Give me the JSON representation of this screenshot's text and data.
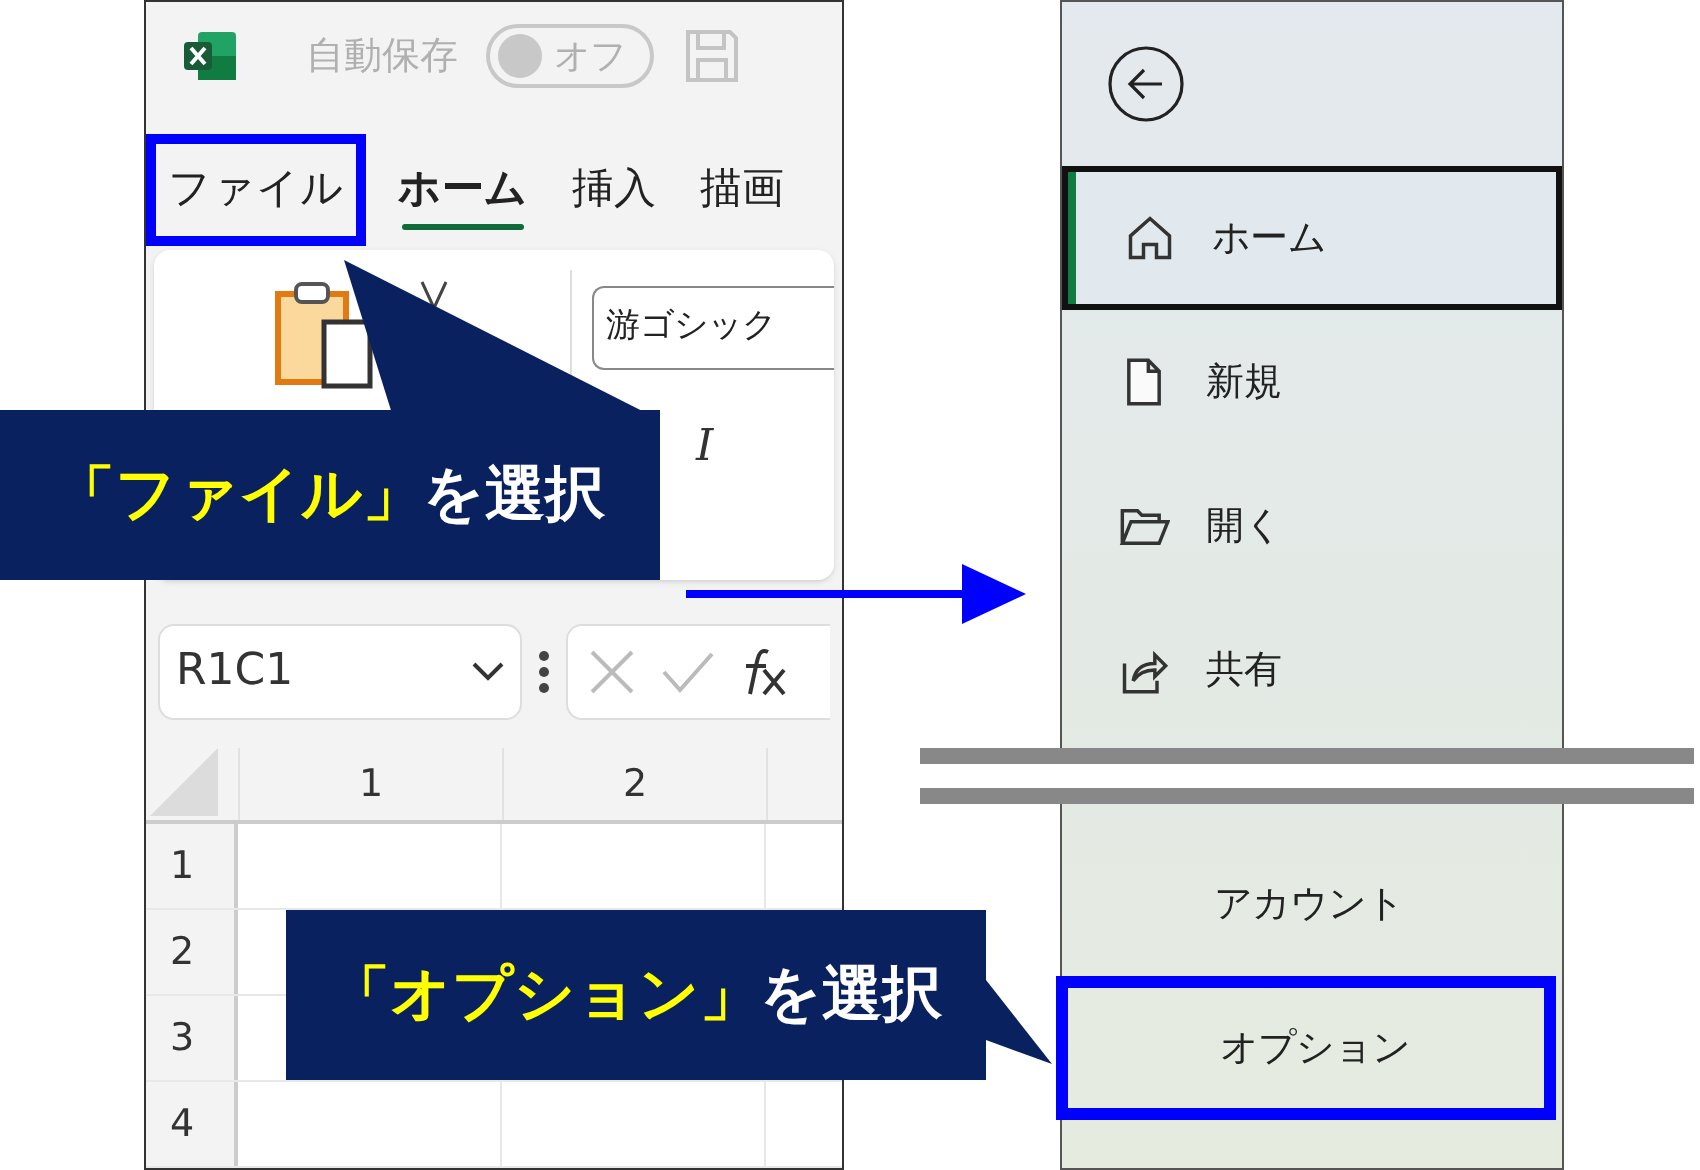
{
  "excel_window": {
    "title_bar": {
      "autosave_label": "自動保存",
      "autosave_toggle": {
        "label": "オフ",
        "on": false
      }
    },
    "tabs": [
      {
        "label": "ファイル",
        "selected": false,
        "highlighted": true
      },
      {
        "label": "ホーム",
        "selected": true,
        "highlighted": false
      },
      {
        "label": "挿入",
        "selected": false,
        "highlighted": false
      },
      {
        "label": "描画",
        "selected": false,
        "highlighted": false
      }
    ],
    "ribbon": {
      "font_name": "游ゴシック",
      "italic_button": "I"
    },
    "formula_bar": {
      "name_box": "R1C1"
    },
    "column_headers": [
      "1",
      "2"
    ],
    "row_headers": [
      "1",
      "2",
      "3",
      "4"
    ]
  },
  "file_menu": {
    "items": [
      {
        "label": "ホーム",
        "kind": "icon",
        "selected": true,
        "highlighted": false
      },
      {
        "label": "新規",
        "kind": "icon",
        "selected": false,
        "highlighted": false
      },
      {
        "label": "開く",
        "kind": "icon",
        "selected": false,
        "highlighted": false
      },
      {
        "label": "共有",
        "kind": "icon",
        "selected": false,
        "highlighted": false
      },
      {
        "label": "アカウント",
        "kind": "text",
        "selected": false,
        "highlighted": false
      },
      {
        "label": "オプション",
        "kind": "text",
        "selected": false,
        "highlighted": true
      }
    ]
  },
  "callouts": [
    {
      "parts": [
        {
          "text": "「ファイル」",
          "emphasis": true
        },
        {
          "text": "を選択",
          "emphasis": false
        }
      ]
    },
    {
      "parts": [
        {
          "text": "「オプション」",
          "emphasis": true
        },
        {
          "text": "を選択",
          "emphasis": false
        }
      ]
    }
  ]
}
